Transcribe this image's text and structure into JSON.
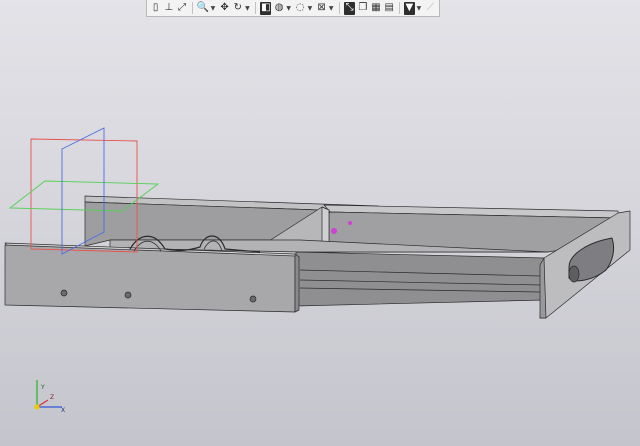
{
  "toolbar": {
    "buttons": [
      {
        "name": "show-tree-icon",
        "glyph": "▯",
        "dropdown": false,
        "active": false,
        "disabled": false
      },
      {
        "name": "orientation-icon",
        "glyph": "⊥",
        "dropdown": false,
        "active": false,
        "disabled": false
      },
      {
        "name": "zoom-all-icon",
        "glyph": "⤢",
        "dropdown": false,
        "active": false,
        "disabled": false
      },
      {
        "name": "zoom-icon",
        "glyph": "🔍",
        "dropdown": true,
        "active": false,
        "disabled": false
      },
      {
        "name": "pan-icon",
        "glyph": "✥",
        "dropdown": false,
        "active": false,
        "disabled": false
      },
      {
        "name": "rotate-icon",
        "glyph": "↻",
        "dropdown": true,
        "active": false,
        "disabled": false
      },
      {
        "name": "view-orientation-icon",
        "glyph": "◧",
        "dropdown": false,
        "active": true,
        "disabled": false
      },
      {
        "name": "display-style-icon",
        "glyph": "◍",
        "dropdown": true,
        "active": false,
        "disabled": false
      },
      {
        "name": "hidden-lines-icon",
        "glyph": "◌",
        "dropdown": true,
        "active": false,
        "disabled": false
      },
      {
        "name": "section-view-icon",
        "glyph": "⊠",
        "dropdown": true,
        "active": false,
        "disabled": false
      },
      {
        "name": "perspective-icon",
        "glyph": "⤡",
        "dropdown": false,
        "active": true,
        "disabled": false
      },
      {
        "name": "copy-view-icon",
        "glyph": "❐",
        "dropdown": false,
        "active": false,
        "disabled": false
      },
      {
        "name": "colors-icon",
        "glyph": "▦",
        "dropdown": false,
        "active": false,
        "disabled": false
      },
      {
        "name": "materials-icon",
        "glyph": "▤",
        "dropdown": false,
        "active": false,
        "disabled": false
      },
      {
        "name": "filter-icon",
        "glyph": "▼",
        "dropdown": true,
        "active": true,
        "disabled": false
      },
      {
        "name": "measure-icon",
        "glyph": "⟋",
        "dropdown": false,
        "active": false,
        "disabled": true
      }
    ]
  },
  "viewport": {
    "background_top": "#e3e3e8",
    "background_bottom": "#c4c5cc",
    "body_color": "#a9a9ab",
    "plane_xy_color": "#e8534e",
    "plane_xz_color": "#56d056",
    "plane_yz_color": "#4c6ee0",
    "point_color": "#d23fd4",
    "triad_labels": {
      "x": "X",
      "y": "Y",
      "z": "Z"
    }
  }
}
